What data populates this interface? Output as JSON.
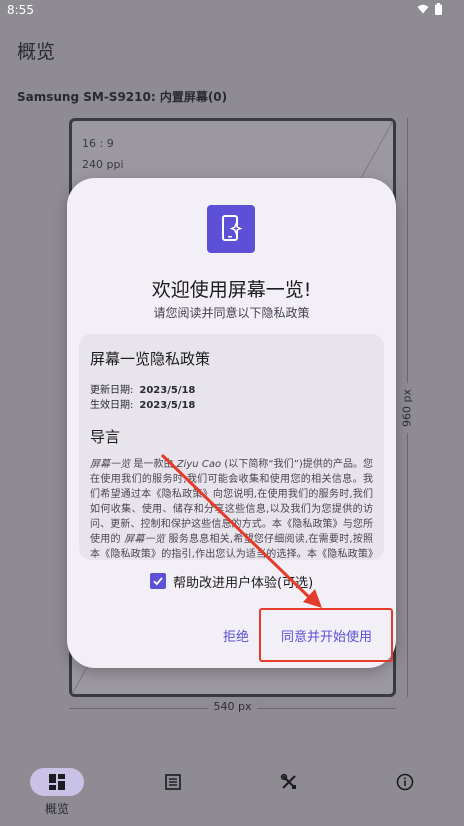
{
  "status_bar": {
    "time": "8:55",
    "icons": [
      "wifi-icon",
      "battery-icon"
    ]
  },
  "page": {
    "title": "概览",
    "device_name": "Samsung SM-S9210: 内置屏幕(0)"
  },
  "screen_preview": {
    "aspect_ratio": "16 : 9",
    "density": "240 ppi",
    "width_label": "540 px",
    "height_label": "960 px"
  },
  "dialog": {
    "icon": "phone-sparkle-icon",
    "title": "欢迎使用屏幕一览!",
    "subtitle": "请您阅读并同意以下隐私政策",
    "policy": {
      "title": "屏幕一览隐私政策",
      "updated_label": "更新日期:",
      "updated_value": "2023/5/18",
      "effective_label": "生效日期:",
      "effective_value": "2023/5/18",
      "section_title": "导言",
      "body": {
        "app_name": "屏幕一览",
        "part1": " 是一款由 ",
        "author": "Ziyu Cao",
        "part2": " (以下简称“我们”)提供的产品。您在使用我们的服务时,我们可能会收集和使用您的相关信息。我们希望通过本《隐私政策》向您说明,在使用我们的服务时,我们如何收集、使用、储存和分享这些信息,以及我们为您提供的访问、更新、控制和保护这些信息的方式。本《隐私政策》与您所使用的 ",
        "app_name_2": "屏幕一览",
        "part3": " 服务息息相关,希望您仔细阅读,在需要时,按照本《隐私政策》的指引,作出您认为适当的选择。本《隐私政策》中涉及的相关技术词汇,我们尽量"
      }
    },
    "consent_label": "帮助改进用户体验(可选)",
    "consent_checked": true,
    "decline_label": "拒绝",
    "agree_label": "同意并开始使用"
  },
  "bottom_nav": [
    {
      "icon": "dashboard-icon",
      "label": "概览",
      "active": true
    },
    {
      "icon": "list-icon",
      "label": "",
      "active": false
    },
    {
      "icon": "tools-icon",
      "label": "",
      "active": false
    },
    {
      "icon": "info-icon",
      "label": "",
      "active": false
    }
  ],
  "colors": {
    "accent": "#5b50d6",
    "annotation": "#e53b2b",
    "scrim": "#8f8b93"
  }
}
